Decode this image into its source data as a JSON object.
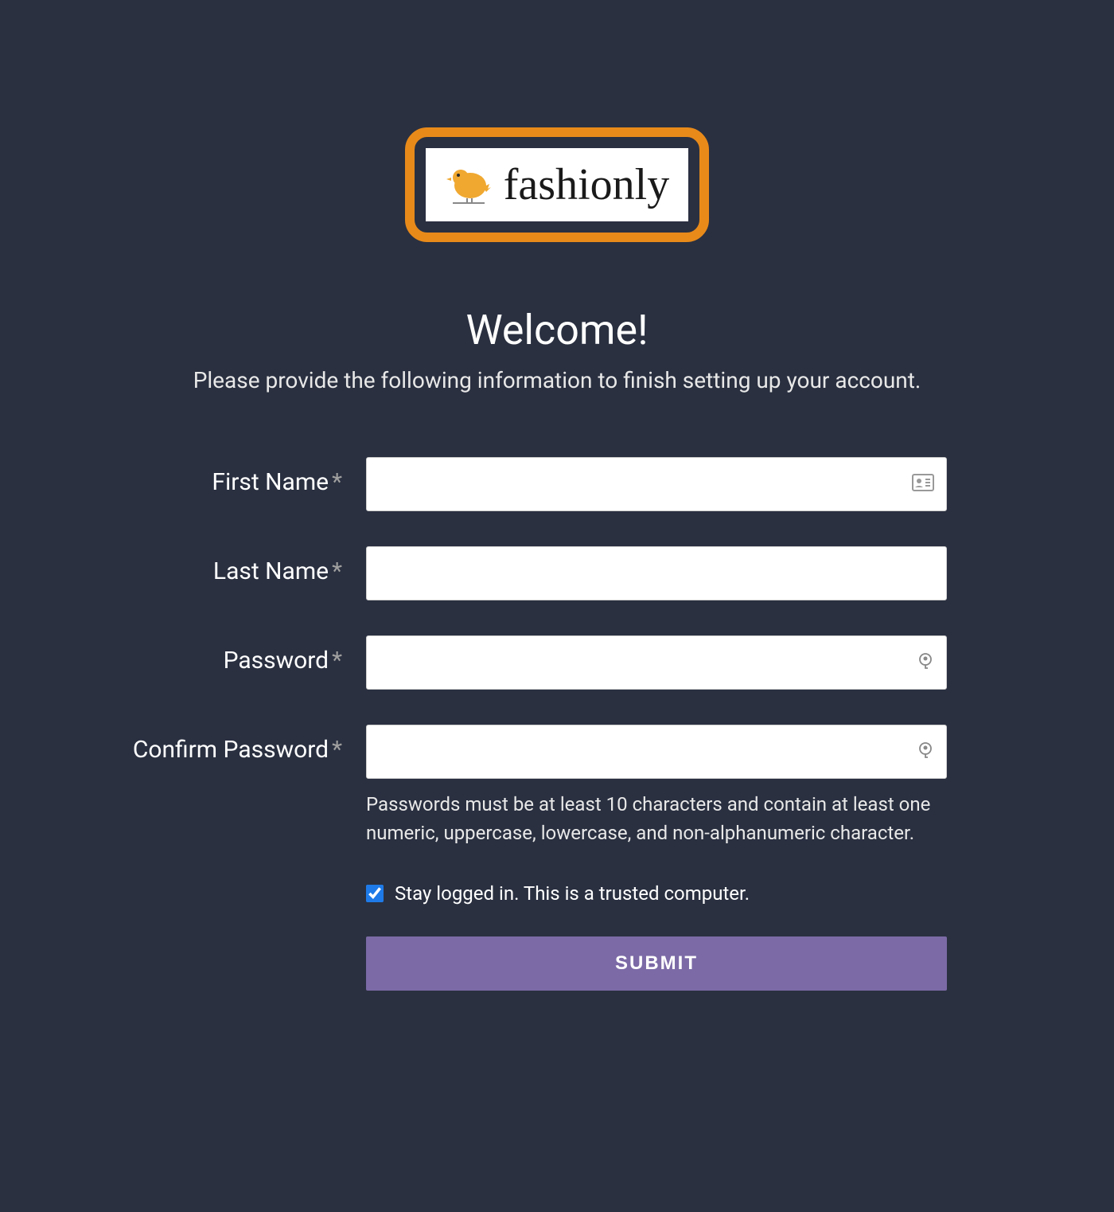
{
  "logo": {
    "brand_name": "fashionly"
  },
  "header": {
    "title": "Welcome!",
    "subtitle": "Please provide the following information to finish setting up your account."
  },
  "form": {
    "first_name": {
      "label": "First Name",
      "value": ""
    },
    "last_name": {
      "label": "Last Name",
      "value": ""
    },
    "password": {
      "label": "Password",
      "value": ""
    },
    "confirm_password": {
      "label": "Confirm Password",
      "value": "",
      "hint": "Passwords must be at least 10 characters and contain at least one numeric, uppercase, lowercase, and non-alphanumeric character."
    },
    "stay_logged_in": {
      "label": "Stay logged in. This is a trusted computer.",
      "checked": true
    },
    "submit_label": "SUBMIT",
    "required_marker": "*"
  }
}
